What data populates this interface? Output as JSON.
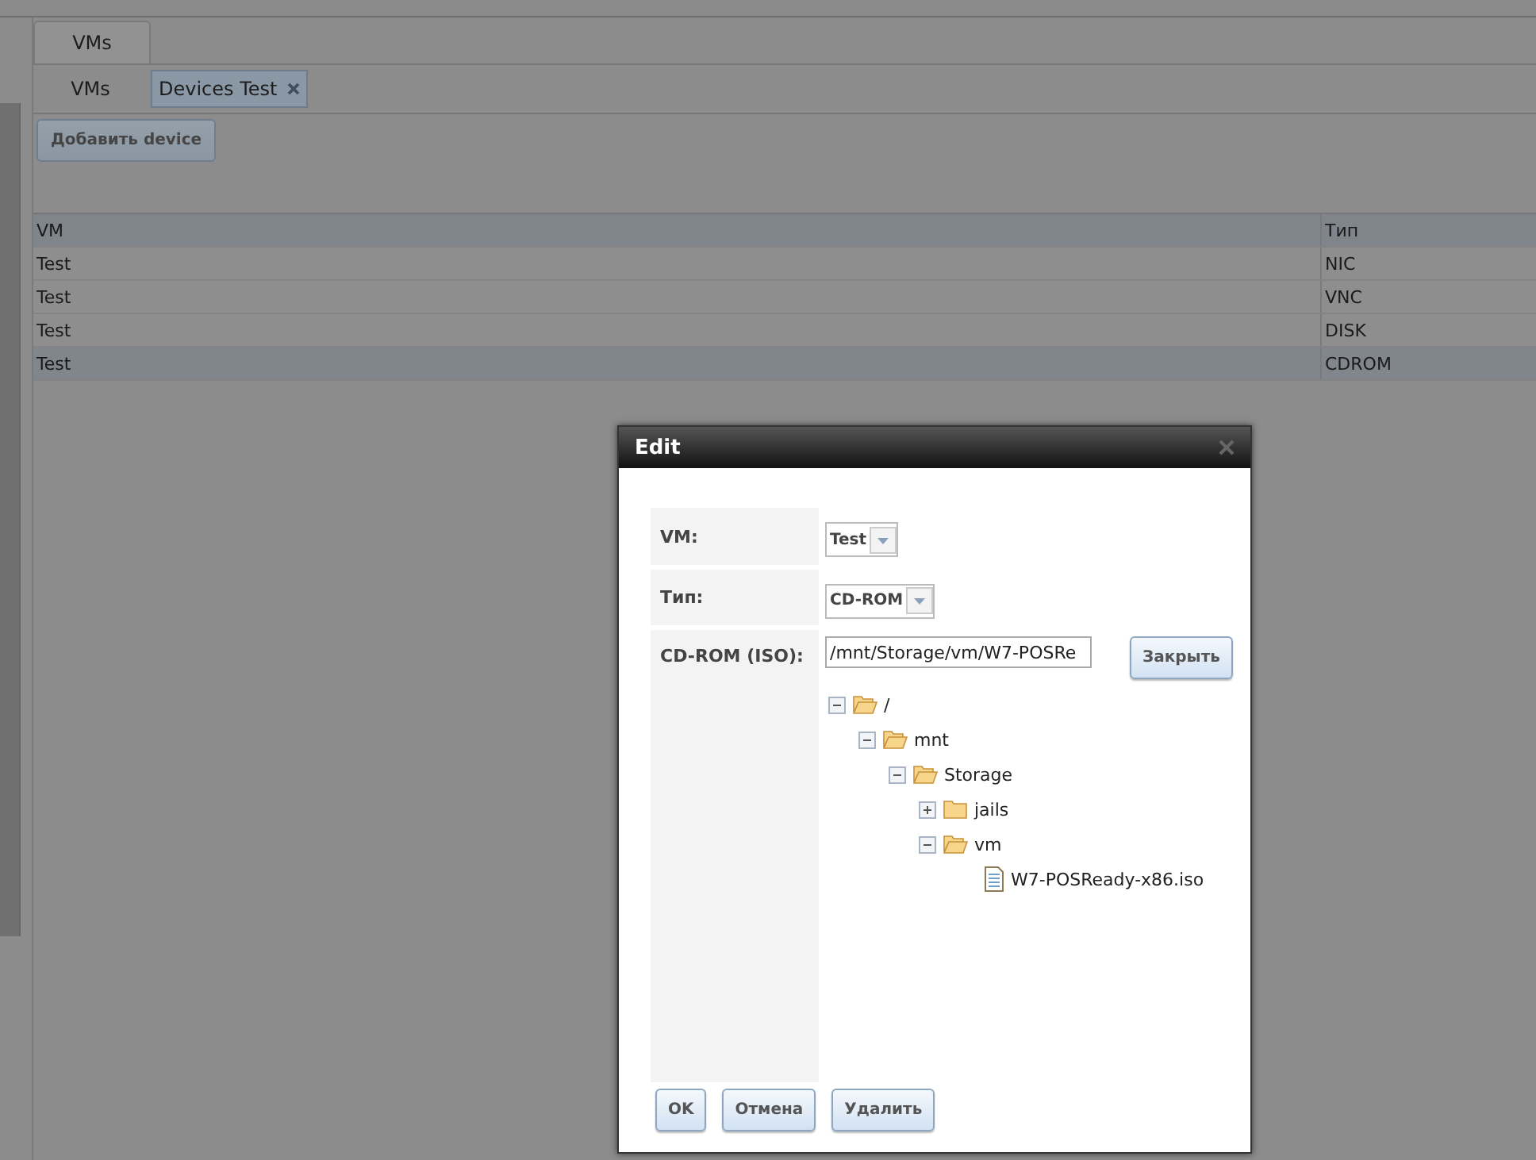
{
  "tabs": [
    {
      "label": "VMs",
      "selected": true
    }
  ],
  "subtabs": [
    {
      "label": "VMs",
      "selected": false,
      "closable": false
    },
    {
      "label": "Devices Test",
      "selected": true,
      "closable": true
    }
  ],
  "add_button": "Добавить device",
  "table": {
    "columns": [
      "VM",
      "Тип"
    ],
    "rows": [
      {
        "cells": [
          "Test",
          "NIC"
        ],
        "selected": false
      },
      {
        "cells": [
          "Test",
          "VNC"
        ],
        "selected": false
      },
      {
        "cells": [
          "Test",
          "DISK"
        ],
        "selected": false
      },
      {
        "cells": [
          "Test",
          "CDROM"
        ],
        "selected": true
      }
    ]
  },
  "dialog": {
    "title": "Edit",
    "fields": [
      {
        "kind": "select",
        "label": "VM:",
        "value": "Test"
      },
      {
        "kind": "select",
        "label": "Тип:",
        "value": "CD-ROM"
      },
      {
        "kind": "path",
        "label": "CD-ROM (ISO):",
        "value": "/mnt/Storage/vm/W7-POSRe",
        "button": "Закрыть",
        "tree": [
          {
            "label": "/",
            "kind": "folder",
            "expanded": true,
            "children": [
              {
                "label": "mnt",
                "kind": "folder",
                "expanded": true,
                "children": [
                  {
                    "label": "Storage",
                    "kind": "folder",
                    "expanded": true,
                    "children": [
                      {
                        "label": "jails",
                        "kind": "folder",
                        "expanded": false
                      },
                      {
                        "label": "vm",
                        "kind": "folder",
                        "expanded": true,
                        "children": [
                          {
                            "label": "W7-POSReady-x86.iso",
                            "kind": "file"
                          }
                        ]
                      }
                    ]
                  }
                ]
              }
            ]
          }
        ]
      }
    ],
    "buttons": [
      "OK",
      "Отмена",
      "Удалить"
    ]
  }
}
